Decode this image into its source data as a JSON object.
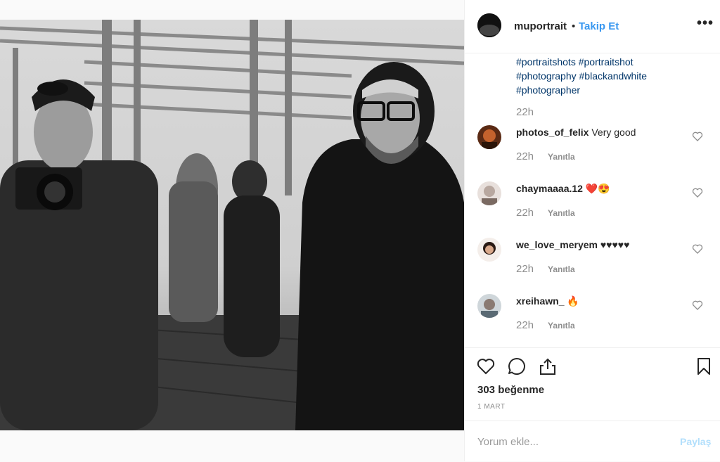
{
  "post": {
    "username": "muportrait",
    "separator": "•",
    "follow_label": "Takip Et",
    "more_label": "•••"
  },
  "caption": {
    "hashtags": [
      "#portraitshots #portraitshot",
      "#photography #blackandwhite",
      "#photographer"
    ],
    "time": "22h"
  },
  "comments": [
    {
      "user": "photos_of_felix",
      "text": "Very good",
      "time": "22h",
      "reply_label": "Yanıtla"
    },
    {
      "user": "chaymaaaa.12",
      "text": "❤️😍",
      "time": "22h",
      "reply_label": "Yanıtla"
    },
    {
      "user": "we_love_meryem",
      "text": "♥♥♥♥♥",
      "time": "22h",
      "reply_label": "Yanıtla"
    },
    {
      "user": "xreihawn_",
      "text": "🔥",
      "time": "22h",
      "reply_label": "Yanıtla"
    }
  ],
  "actions": {
    "likes": "303 beğenme",
    "date": "1 MART",
    "icons": [
      "heart-icon",
      "comment-icon",
      "share-icon",
      "bookmark-icon"
    ]
  },
  "add_comment": {
    "placeholder": "Yorum ekle...",
    "share_label": "Paylaş"
  },
  "colors": {
    "accent": "#3897f0",
    "hashtag": "#003569",
    "muted": "#8e8e8e",
    "share_disabled": "#b2dffc"
  }
}
